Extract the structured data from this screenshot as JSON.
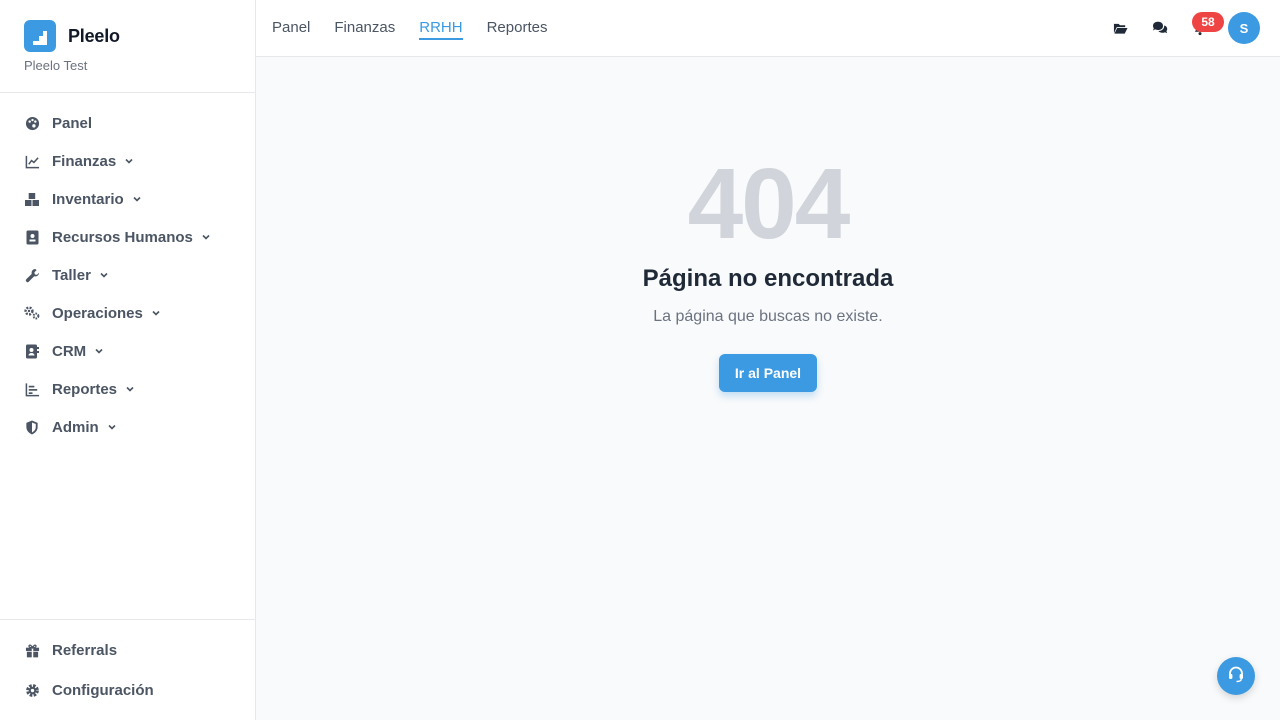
{
  "brand": {
    "name": "Pleelo",
    "subtitle": "Pleelo Test",
    "accent": "#3b9ae1"
  },
  "sidebar": {
    "items": [
      {
        "label": "Panel",
        "icon": "palette-icon",
        "expandable": false
      },
      {
        "label": "Finanzas",
        "icon": "chart-line-icon",
        "expandable": true
      },
      {
        "label": "Inventario",
        "icon": "boxes-icon",
        "expandable": true
      },
      {
        "label": "Recursos Humanos",
        "icon": "id-badge-icon",
        "expandable": true
      },
      {
        "label": "Taller",
        "icon": "wrench-icon",
        "expandable": true
      },
      {
        "label": "Operaciones",
        "icon": "gears-icon",
        "expandable": true
      },
      {
        "label": "CRM",
        "icon": "address-book-icon",
        "expandable": true
      },
      {
        "label": "Reportes",
        "icon": "bar-chart-icon",
        "expandable": true
      },
      {
        "label": "Admin",
        "icon": "shield-icon",
        "expandable": true
      }
    ],
    "bottom": [
      {
        "label": "Referrals",
        "icon": "gift-icon"
      },
      {
        "label": "Configuración",
        "icon": "gear-icon"
      }
    ]
  },
  "topbar": {
    "tabs": [
      {
        "label": "Panel",
        "active": false
      },
      {
        "label": "Finanzas",
        "active": false
      },
      {
        "label": "RRHH",
        "active": true
      },
      {
        "label": "Reportes",
        "active": false
      }
    ],
    "icons": [
      "folder-open-icon",
      "comments-icon",
      "bell-icon"
    ],
    "notification_count": "58",
    "avatar_initial": "S"
  },
  "error_page": {
    "code": "404",
    "title": "Página no encontrada",
    "message": "La página que buscas no existe.",
    "button_label": "Ir al Panel"
  },
  "help_button": {
    "icon": "headset-icon"
  },
  "colors": {
    "accent": "#3b9ae1",
    "badge": "#ef4444",
    "muted_code": "#d1d5db"
  }
}
